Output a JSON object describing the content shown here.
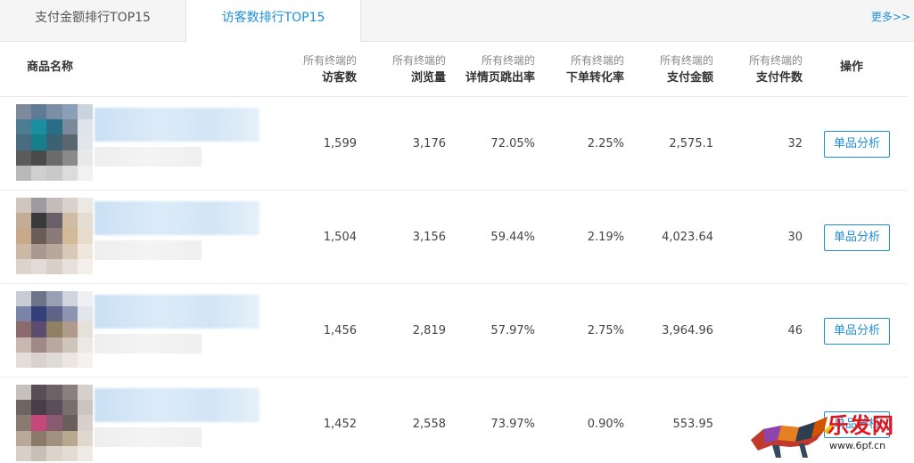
{
  "tabs": [
    {
      "label": "支付金额排行TOP15",
      "active": false
    },
    {
      "label": "访客数排行TOP15",
      "active": true
    }
  ],
  "more_label": "更多>>",
  "accent_color": "#1f8fd8",
  "header": {
    "name": "商品名称",
    "operation": "操作",
    "columns": [
      {
        "sub": "所有终端的",
        "main": "访客数"
      },
      {
        "sub": "所有终端的",
        "main": "浏览量"
      },
      {
        "sub": "所有终端的",
        "main": "详情页跳出率"
      },
      {
        "sub": "所有终端的",
        "main": "下单转化率"
      },
      {
        "sub": "所有终端的",
        "main": "支付金额"
      },
      {
        "sub": "所有终端的",
        "main": "支付件数"
      }
    ]
  },
  "rows": [
    {
      "visitors": "1,599",
      "pageviews": "3,176",
      "bounce": "72.05%",
      "conversion": "2.25%",
      "amount": "2,575.1",
      "count": "32",
      "button": "单品分析",
      "thumb": [
        "#7d8a9c",
        "#5f7a94",
        "#7a8fa6",
        "#8aa0b8",
        "#c9d4de",
        "#4e7c93",
        "#1b8fa0",
        "#2a6d84",
        "#7a8a9a",
        "#dfe4ea",
        "#4a6b80",
        "#157f8c",
        "#3b6172",
        "#5a6670",
        "#e2e6ea",
        "#5b5b5b",
        "#4a4a4a",
        "#6b6b6b",
        "#8a8a8a",
        "#e8e8e8",
        "#b9b9b9",
        "#cfcfcf",
        "#c9c9c9",
        "#dcdcdc",
        "#f1f1f1"
      ]
    },
    {
      "visitors": "1,504",
      "pageviews": "3,156",
      "bounce": "59.44%",
      "conversion": "2.19%",
      "amount": "4,023.64",
      "count": "30",
      "button": "单品分析",
      "thumb": [
        "#cfc6bf",
        "#9e9aa0",
        "#c4bcb8",
        "#d9d2cc",
        "#ece8e4",
        "#c3ad96",
        "#3a3a3c",
        "#6b6068",
        "#d0bca5",
        "#e6ddd2",
        "#c9a98c",
        "#6a5c56",
        "#8a7b78",
        "#d4b89a",
        "#e8dccd",
        "#cbb8a6",
        "#a89890",
        "#b8a89c",
        "#d8c8b6",
        "#efe6dc",
        "#ddd3cb",
        "#e3dcd6",
        "#d8cfc8",
        "#e7e0da",
        "#f3efeb"
      ]
    },
    {
      "visitors": "1,456",
      "pageviews": "2,819",
      "bounce": "57.97%",
      "conversion": "2.75%",
      "amount": "3,964.96",
      "count": "46",
      "button": "单品分析",
      "thumb": [
        "#c9ccd4",
        "#6e7488",
        "#9aa0b4",
        "#d0d4dc",
        "#eef0f4",
        "#7a83a8",
        "#353f7a",
        "#5e6487",
        "#8d94b0",
        "#e2e5ec",
        "#8a6a6a",
        "#5c4d70",
        "#8e8060",
        "#b09a8c",
        "#e6e0da",
        "#c8b8b0",
        "#a08a88",
        "#b8a8a0",
        "#cfc4bc",
        "#eee8e4",
        "#e4dedb",
        "#d9d2ce",
        "#e0dad6",
        "#ebe6e2",
        "#f4f1ef"
      ]
    },
    {
      "visitors": "1,452",
      "pageviews": "2,558",
      "bounce": "73.97%",
      "conversion": "0.90%",
      "amount": "553.95",
      "count": "",
      "button": "单品分析",
      "thumb": [
        "#c6c1bd",
        "#5a4e54",
        "#6e6266",
        "#8a7e80",
        "#d6d0cc",
        "#6e6460",
        "#4a3d48",
        "#5c4d5a",
        "#7a6e6c",
        "#cbc5c0",
        "#8a7a70",
        "#c4487a",
        "#8a5a70",
        "#6a5e58",
        "#d8d0ca",
        "#b8a898",
        "#8a7a6a",
        "#a09080",
        "#b8a890",
        "#e0d8cf",
        "#d8cfc6",
        "#c8bfb6",
        "#dcd4cb",
        "#e2dcd5",
        "#eeeae6"
      ]
    }
  ],
  "watermark": {
    "logo_text": "乐发网",
    "url": "www.6pf.cn"
  }
}
